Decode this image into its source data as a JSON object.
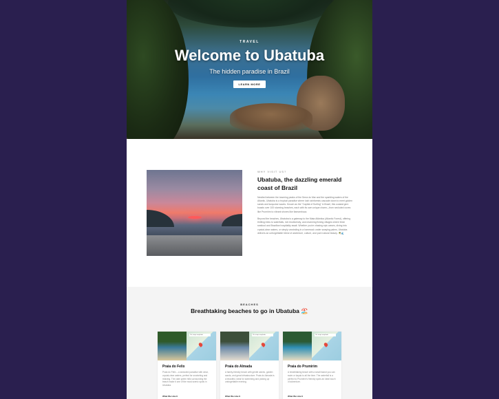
{
  "hero": {
    "kicker": "TRAVEL",
    "title": "Welcome to Ubatuba",
    "subtitle": "The hidden paradise in Brazil",
    "button_label": "LEARN MORE"
  },
  "about": {
    "kicker": "WHY VISIT US?",
    "title": "Ubatuba, the dazzling emerald coast of Brazil",
    "paragraph1": "Nestled between the towering peaks of the Serra do Mar and the sparkling waters of the Atlantic, Ubatuba is a tropical paradise where lush rainforests cascade down to meet golden sands and turquoise waves. Known as the \"Capital of Surfing\" in Brazil, this coastal gem boasts over 100 stunning beaches, each with its own unique charm—from secluded coves like Prumirim to vibrant shores like Itamambuca.",
    "paragraph2": "Beyond the beaches, Ubatuba is a gateway to the Mata Atlântica (Atlantic Forest), offering thrilling treks to waterfalls, rich biodiversity, and charming fishing villages where fresh seafood and Brazilian hospitality await. Whether you're chasing epic waves, diving into crystal-clear waters, or simply unwinding in a hammock under swaying palms, Ubatuba delivers an unforgettable blend of adventure, culture, and pure natural beauty. 🌴🌊"
  },
  "beaches": {
    "kicker": "BEACHES",
    "title": "Breathtaking beaches to go in Ubatuba 🏖️",
    "cards": [
      {
        "name": "Praia do Felix",
        "map_tag": "Ver mapa ampliado",
        "description": "Praia do Felix – a secluded paradise with clear, crystal-clear waters, perfect for snorkeling and relaxing. The calm green hills surrounding the beach make it one of the most scenic spots in Ubatuba.",
        "more_label": "What We Like It",
        "photo_colors": [
          "#2f5a2a",
          "#3a7a9a",
          "#d9c79a"
        ]
      },
      {
        "name": "Praia do Almada",
        "map_tag": "Ver mapa ampliado",
        "description": "A family-friendly beach with gentle waves, golden sands, and great infrastructure. Praia do Almada is a beautiful, ideal for swimming and picking up unforgettable evening.",
        "more_label": "What We Like It",
        "photo_colors": [
          "#3d4f3a",
          "#6c8aa8",
          "#e4dccf"
        ]
      },
      {
        "name": "Praia do Prumirim",
        "map_tag": "Ver mapa ampliado",
        "description": "A breathtaking beach with a small island you can swim or kayak to all the time. The waterfall is a perfect to Prumirim's friendly spots an ideal touch of adventure.",
        "more_label": "What We Like It",
        "photo_colors": [
          "#2c5a34",
          "#2f8fb5",
          "#e8dcc0"
        ]
      }
    ]
  }
}
